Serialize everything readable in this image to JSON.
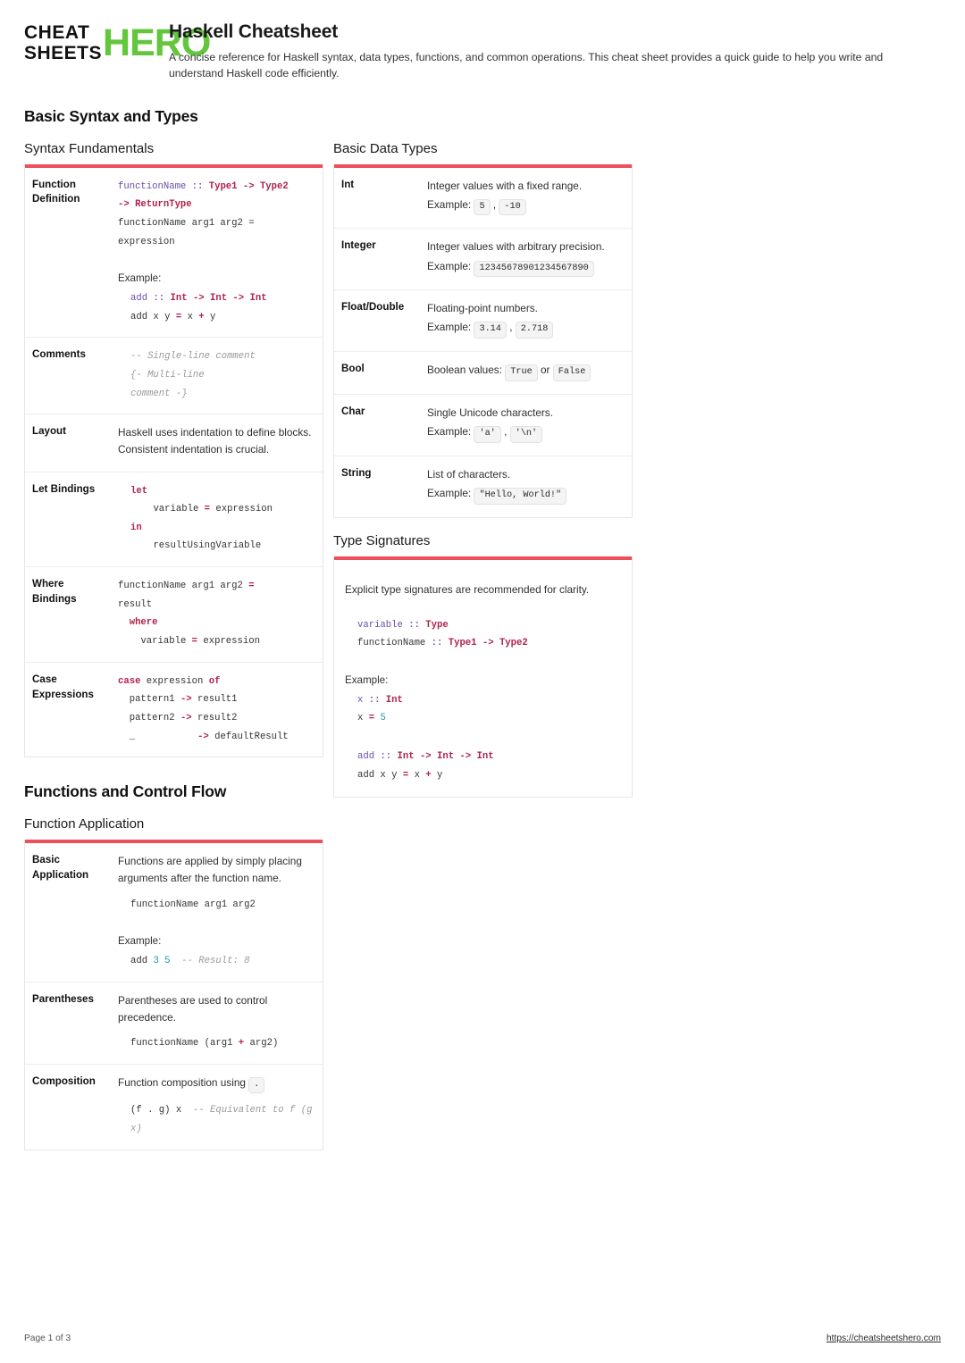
{
  "brand": {
    "logo_line1": "CHEAT",
    "logo_line2": "SHEETS",
    "logo_accent": "HERO",
    "accent_color": "#63c63c"
  },
  "header": {
    "title": "Haskell Cheatsheet",
    "description": "A concise reference for Haskell syntax, data types, functions, and common operations. This cheat sheet provides a quick guide to help you write and understand Haskell code efficiently."
  },
  "theme": {
    "rule_color": "#ef4e5c",
    "keyword_color": "#b0224c",
    "function_color": "#6b4fa8",
    "number_color": "#2196ac",
    "comment_color": "#9a9a9a"
  },
  "sections": {
    "basic_syntax": {
      "title": "Basic Syntax and Types"
    },
    "functions_control_flow": {
      "title": "Functions and Control Flow"
    }
  },
  "syntax_fundamentals": {
    "title": "Syntax Fundamentals",
    "rows": {
      "function_definition": {
        "label": "Function Definition",
        "code_sig_1": "functionName",
        "code_sig_op": " :: ",
        "code_sig_types": "Type1 -> Type2",
        "code_sig_2": "-> ReturnType",
        "code_body": "functionName arg1 arg2 =\nexpression",
        "example_label": "Example:",
        "example_name": "add",
        "example_op": " :: ",
        "example_types": "Int -> Int -> Int",
        "example_body_pre": "add x y ",
        "example_body_eq": "=",
        "example_body_post": " x ",
        "example_body_plus": "+",
        "example_body_end": " y"
      },
      "comments": {
        "label": "Comments",
        "line1": "-- Single-line comment",
        "line2": "{- Multi-line",
        "line3": "comment -}"
      },
      "layout": {
        "label": "Layout",
        "text": "Haskell uses indentation to define blocks. Consistent indentation is crucial."
      },
      "let_bindings": {
        "label": "Let Bindings",
        "kw_let": "let",
        "line_var": "    variable ",
        "line_eq": "=",
        "line_expr": " expression",
        "kw_in": "in",
        "line_result": "    resultUsingVariable"
      },
      "where_bindings": {
        "label": "Where Bindings",
        "line1_pre": "functionName arg1 arg2 ",
        "line1_eq": "=",
        "line2": "result",
        "kw_where": "  where",
        "line4_pre": "    variable ",
        "line4_eq": "=",
        "line4_post": " expression"
      },
      "case_expressions": {
        "label": "Case Expressions",
        "kw_case": "case",
        "case_mid": " expression ",
        "kw_of": "of",
        "p1_pre": "  pattern1 ",
        "p1_arrow": "->",
        "p1_post": " result1",
        "p2_pre": "  pattern2 ",
        "p2_arrow": "->",
        "p2_post": " result2",
        "p3_pre": "  _           ",
        "p3_arrow": "->",
        "p3_post": " defaultResult"
      }
    }
  },
  "basic_data_types": {
    "title": "Basic Data Types",
    "example_label": "Example:",
    "rows": [
      {
        "name": "Int",
        "desc": "Integer values with a fixed range.",
        "has_example": true,
        "examples": [
          "5",
          "-10"
        ],
        "separator": ","
      },
      {
        "name": "Integer",
        "desc": "Integer values with arbitrary precision.",
        "has_example": true,
        "examples": [
          "12345678901234567890"
        ],
        "separator": ""
      },
      {
        "name": "Float/Double",
        "desc": "Floating-point numbers.",
        "has_example": true,
        "examples": [
          "3.14",
          "2.718"
        ],
        "separator": ","
      },
      {
        "name": "Bool",
        "desc": "Boolean values:",
        "inline": true,
        "examples": [
          "True",
          "False"
        ],
        "separator": "or"
      },
      {
        "name": "Char",
        "desc": "Single Unicode characters.",
        "has_example": true,
        "examples": [
          "'a'",
          "'\\n'"
        ],
        "separator": ","
      },
      {
        "name": "String",
        "desc": "List of characters.",
        "has_example": true,
        "examples": [
          "\"Hello, World!\""
        ],
        "separator": ""
      }
    ]
  },
  "type_signatures": {
    "title": "Type Signatures",
    "intro": "Explicit type signatures are recommended for clarity.",
    "sig1_name": "variable",
    "sig1_op": " :: ",
    "sig1_type": "Type",
    "sig2_name": "functionName",
    "sig2_op": " :: ",
    "sig2_type": "Type1 -> Type2",
    "example_label": "Example:",
    "ex1_name": "x",
    "ex1_op": " :: ",
    "ex1_type": "Int",
    "ex2_name": "x ",
    "ex2_eq": "=",
    "ex2_val": "5",
    "ex3_name": "add",
    "ex3_op": " :: ",
    "ex3_type": "Int -> Int -> Int",
    "ex4_pre": "add x y ",
    "ex4_eq": "=",
    "ex4_mid": " x ",
    "ex4_plus": "+",
    "ex4_post": " y"
  },
  "function_application": {
    "title": "Function Application",
    "rows": {
      "basic_application": {
        "label": "Basic Application",
        "text": "Functions are applied by simply placing arguments after the function name.",
        "code": "functionName arg1 arg2",
        "example_label": "Example:",
        "ex_pre": "add ",
        "ex_n1": "3",
        "ex_sp": " ",
        "ex_n2": "5",
        "ex_comment": "  -- Result: 8"
      },
      "parentheses": {
        "label": "Parentheses",
        "text": "Parentheses are used to control precedence.",
        "code_pre": "functionName (arg1 ",
        "code_plus": "+",
        "code_post": " arg2)"
      },
      "composition": {
        "label": "Composition",
        "text_pre": "Function composition using",
        "chip": ".",
        "code_pre": "(f . g) x",
        "code_comment": "  -- Equivalent to f (g x)"
      }
    }
  },
  "footer": {
    "page_label": "Page 1 of 3",
    "url": "https://cheatsheetshero.com"
  }
}
